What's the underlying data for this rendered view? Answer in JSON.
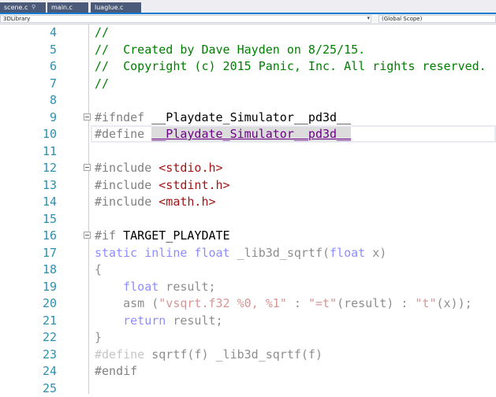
{
  "tabs": [
    {
      "label": "scene.c",
      "pin": "⚲"
    },
    {
      "label": "main.c"
    },
    {
      "label": "luaglue.c"
    }
  ],
  "nav": {
    "project": "3DLibrary",
    "scope": "(Global Scope)"
  },
  "lines": [
    {
      "n": "4",
      "tokens": [
        [
          "c-comment",
          "//"
        ]
      ]
    },
    {
      "n": "5",
      "tokens": [
        [
          "c-comment",
          "//  Created by Dave Hayden on 8/25/15."
        ]
      ]
    },
    {
      "n": "6",
      "tokens": [
        [
          "c-comment",
          "//  Copyright (c) 2015 Panic, Inc. All rights reserved."
        ]
      ]
    },
    {
      "n": "7",
      "tokens": [
        [
          "c-comment",
          "//"
        ]
      ]
    },
    {
      "n": "8",
      "tokens": []
    },
    {
      "n": "9",
      "fold": true,
      "tokens": [
        [
          "c-pre",
          "#ifndef "
        ],
        [
          "c-id",
          "__Playdate_Simulator__pd3d__"
        ]
      ]
    },
    {
      "n": "10",
      "current": true,
      "tokens": [
        [
          "c-pre",
          "#define "
        ],
        [
          "c-macro hl-def",
          "__Playdate_Simulator__pd3d__"
        ]
      ]
    },
    {
      "n": "11",
      "tokens": []
    },
    {
      "n": "12",
      "fold": true,
      "tokens": [
        [
          "c-pre",
          "#include "
        ],
        [
          "c-inc",
          "<stdio.h>"
        ]
      ]
    },
    {
      "n": "13",
      "tokens": [
        [
          "c-pre",
          "#include "
        ],
        [
          "c-inc",
          "<stdint.h>"
        ]
      ]
    },
    {
      "n": "14",
      "tokens": [
        [
          "c-pre",
          "#include "
        ],
        [
          "c-inc",
          "<math.h>"
        ]
      ]
    },
    {
      "n": "15",
      "tokens": []
    },
    {
      "n": "16",
      "fold": true,
      "tokens": [
        [
          "c-pre",
          "#if "
        ],
        [
          "c-id",
          "TARGET_PLAYDATE"
        ]
      ]
    },
    {
      "n": "17",
      "tokens": [
        [
          "c-kw dim",
          "static inline float "
        ],
        [
          "c-id dim",
          "_lib3d_sqrtf("
        ],
        [
          "c-kw dim",
          "float"
        ],
        [
          "c-id dim",
          " x)"
        ]
      ]
    },
    {
      "n": "18",
      "tokens": [
        [
          "c-id dim",
          "{"
        ]
      ]
    },
    {
      "n": "19",
      "tokens": [
        [
          "c-id dim",
          "    "
        ],
        [
          "c-kw dim",
          "float"
        ],
        [
          "c-id dim",
          " result;"
        ]
      ]
    },
    {
      "n": "20",
      "tokens": [
        [
          "c-id dim",
          "    asm ("
        ],
        [
          "c-inc dim",
          "\"vsqrt.f32 %0, %1\""
        ],
        [
          "c-id dim",
          " : "
        ],
        [
          "c-inc dim",
          "\"=t\""
        ],
        [
          "c-id dim",
          "(result) : "
        ],
        [
          "c-inc dim",
          "\"t\""
        ],
        [
          "c-id dim",
          "(x));"
        ]
      ]
    },
    {
      "n": "21",
      "tokens": [
        [
          "c-id dim",
          "    "
        ],
        [
          "c-kw dim",
          "return"
        ],
        [
          "c-id dim",
          " result;"
        ]
      ]
    },
    {
      "n": "22",
      "tokens": [
        [
          "c-id dim",
          "}"
        ]
      ]
    },
    {
      "n": "23",
      "tokens": [
        [
          "c-pre dim",
          "#define "
        ],
        [
          "c-id dim",
          "sqrtf(f) _lib3d_sqrtf(f)"
        ]
      ]
    },
    {
      "n": "24",
      "tokens": [
        [
          "c-pre",
          "#endif"
        ]
      ]
    },
    {
      "n": "25",
      "tokens": []
    }
  ]
}
